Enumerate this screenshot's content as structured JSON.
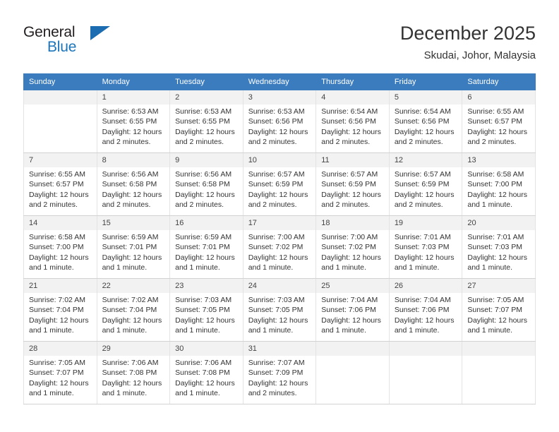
{
  "brand": {
    "name_part1": "General",
    "name_part2": "Blue",
    "logo_icon": "triangle-logo-icon",
    "accent_color": "#1b75bb"
  },
  "header": {
    "title": "December 2025",
    "subtitle": "Skudai, Johor, Malaysia"
  },
  "calendar": {
    "header_color": "#3b7cbf",
    "weekday_headers": [
      "Sunday",
      "Monday",
      "Tuesday",
      "Wednesday",
      "Thursday",
      "Friday",
      "Saturday"
    ],
    "weeks": [
      [
        {
          "day": "",
          "sunrise": "",
          "sunset": "",
          "daylight1": "",
          "daylight2": "",
          "empty": true
        },
        {
          "day": "1",
          "sunrise": "Sunrise: 6:53 AM",
          "sunset": "Sunset: 6:55 PM",
          "daylight1": "Daylight: 12 hours",
          "daylight2": "and 2 minutes."
        },
        {
          "day": "2",
          "sunrise": "Sunrise: 6:53 AM",
          "sunset": "Sunset: 6:55 PM",
          "daylight1": "Daylight: 12 hours",
          "daylight2": "and 2 minutes."
        },
        {
          "day": "3",
          "sunrise": "Sunrise: 6:53 AM",
          "sunset": "Sunset: 6:56 PM",
          "daylight1": "Daylight: 12 hours",
          "daylight2": "and 2 minutes."
        },
        {
          "day": "4",
          "sunrise": "Sunrise: 6:54 AM",
          "sunset": "Sunset: 6:56 PM",
          "daylight1": "Daylight: 12 hours",
          "daylight2": "and 2 minutes."
        },
        {
          "day": "5",
          "sunrise": "Sunrise: 6:54 AM",
          "sunset": "Sunset: 6:56 PM",
          "daylight1": "Daylight: 12 hours",
          "daylight2": "and 2 minutes."
        },
        {
          "day": "6",
          "sunrise": "Sunrise: 6:55 AM",
          "sunset": "Sunset: 6:57 PM",
          "daylight1": "Daylight: 12 hours",
          "daylight2": "and 2 minutes."
        }
      ],
      [
        {
          "day": "7",
          "sunrise": "Sunrise: 6:55 AM",
          "sunset": "Sunset: 6:57 PM",
          "daylight1": "Daylight: 12 hours",
          "daylight2": "and 2 minutes."
        },
        {
          "day": "8",
          "sunrise": "Sunrise: 6:56 AM",
          "sunset": "Sunset: 6:58 PM",
          "daylight1": "Daylight: 12 hours",
          "daylight2": "and 2 minutes."
        },
        {
          "day": "9",
          "sunrise": "Sunrise: 6:56 AM",
          "sunset": "Sunset: 6:58 PM",
          "daylight1": "Daylight: 12 hours",
          "daylight2": "and 2 minutes."
        },
        {
          "day": "10",
          "sunrise": "Sunrise: 6:57 AM",
          "sunset": "Sunset: 6:59 PM",
          "daylight1": "Daylight: 12 hours",
          "daylight2": "and 2 minutes."
        },
        {
          "day": "11",
          "sunrise": "Sunrise: 6:57 AM",
          "sunset": "Sunset: 6:59 PM",
          "daylight1": "Daylight: 12 hours",
          "daylight2": "and 2 minutes."
        },
        {
          "day": "12",
          "sunrise": "Sunrise: 6:57 AM",
          "sunset": "Sunset: 6:59 PM",
          "daylight1": "Daylight: 12 hours",
          "daylight2": "and 2 minutes."
        },
        {
          "day": "13",
          "sunrise": "Sunrise: 6:58 AM",
          "sunset": "Sunset: 7:00 PM",
          "daylight1": "Daylight: 12 hours",
          "daylight2": "and 1 minute."
        }
      ],
      [
        {
          "day": "14",
          "sunrise": "Sunrise: 6:58 AM",
          "sunset": "Sunset: 7:00 PM",
          "daylight1": "Daylight: 12 hours",
          "daylight2": "and 1 minute."
        },
        {
          "day": "15",
          "sunrise": "Sunrise: 6:59 AM",
          "sunset": "Sunset: 7:01 PM",
          "daylight1": "Daylight: 12 hours",
          "daylight2": "and 1 minute."
        },
        {
          "day": "16",
          "sunrise": "Sunrise: 6:59 AM",
          "sunset": "Sunset: 7:01 PM",
          "daylight1": "Daylight: 12 hours",
          "daylight2": "and 1 minute."
        },
        {
          "day": "17",
          "sunrise": "Sunrise: 7:00 AM",
          "sunset": "Sunset: 7:02 PM",
          "daylight1": "Daylight: 12 hours",
          "daylight2": "and 1 minute."
        },
        {
          "day": "18",
          "sunrise": "Sunrise: 7:00 AM",
          "sunset": "Sunset: 7:02 PM",
          "daylight1": "Daylight: 12 hours",
          "daylight2": "and 1 minute."
        },
        {
          "day": "19",
          "sunrise": "Sunrise: 7:01 AM",
          "sunset": "Sunset: 7:03 PM",
          "daylight1": "Daylight: 12 hours",
          "daylight2": "and 1 minute."
        },
        {
          "day": "20",
          "sunrise": "Sunrise: 7:01 AM",
          "sunset": "Sunset: 7:03 PM",
          "daylight1": "Daylight: 12 hours",
          "daylight2": "and 1 minute."
        }
      ],
      [
        {
          "day": "21",
          "sunrise": "Sunrise: 7:02 AM",
          "sunset": "Sunset: 7:04 PM",
          "daylight1": "Daylight: 12 hours",
          "daylight2": "and 1 minute."
        },
        {
          "day": "22",
          "sunrise": "Sunrise: 7:02 AM",
          "sunset": "Sunset: 7:04 PM",
          "daylight1": "Daylight: 12 hours",
          "daylight2": "and 1 minute."
        },
        {
          "day": "23",
          "sunrise": "Sunrise: 7:03 AM",
          "sunset": "Sunset: 7:05 PM",
          "daylight1": "Daylight: 12 hours",
          "daylight2": "and 1 minute."
        },
        {
          "day": "24",
          "sunrise": "Sunrise: 7:03 AM",
          "sunset": "Sunset: 7:05 PM",
          "daylight1": "Daylight: 12 hours",
          "daylight2": "and 1 minute."
        },
        {
          "day": "25",
          "sunrise": "Sunrise: 7:04 AM",
          "sunset": "Sunset: 7:06 PM",
          "daylight1": "Daylight: 12 hours",
          "daylight2": "and 1 minute."
        },
        {
          "day": "26",
          "sunrise": "Sunrise: 7:04 AM",
          "sunset": "Sunset: 7:06 PM",
          "daylight1": "Daylight: 12 hours",
          "daylight2": "and 1 minute."
        },
        {
          "day": "27",
          "sunrise": "Sunrise: 7:05 AM",
          "sunset": "Sunset: 7:07 PM",
          "daylight1": "Daylight: 12 hours",
          "daylight2": "and 1 minute."
        }
      ],
      [
        {
          "day": "28",
          "sunrise": "Sunrise: 7:05 AM",
          "sunset": "Sunset: 7:07 PM",
          "daylight1": "Daylight: 12 hours",
          "daylight2": "and 1 minute."
        },
        {
          "day": "29",
          "sunrise": "Sunrise: 7:06 AM",
          "sunset": "Sunset: 7:08 PM",
          "daylight1": "Daylight: 12 hours",
          "daylight2": "and 1 minute."
        },
        {
          "day": "30",
          "sunrise": "Sunrise: 7:06 AM",
          "sunset": "Sunset: 7:08 PM",
          "daylight1": "Daylight: 12 hours",
          "daylight2": "and 1 minute."
        },
        {
          "day": "31",
          "sunrise": "Sunrise: 7:07 AM",
          "sunset": "Sunset: 7:09 PM",
          "daylight1": "Daylight: 12 hours",
          "daylight2": "and 2 minutes."
        },
        {
          "day": "",
          "sunrise": "",
          "sunset": "",
          "daylight1": "",
          "daylight2": "",
          "empty": true
        },
        {
          "day": "",
          "sunrise": "",
          "sunset": "",
          "daylight1": "",
          "daylight2": "",
          "empty": true
        },
        {
          "day": "",
          "sunrise": "",
          "sunset": "",
          "daylight1": "",
          "daylight2": "",
          "empty": true
        }
      ]
    ]
  }
}
